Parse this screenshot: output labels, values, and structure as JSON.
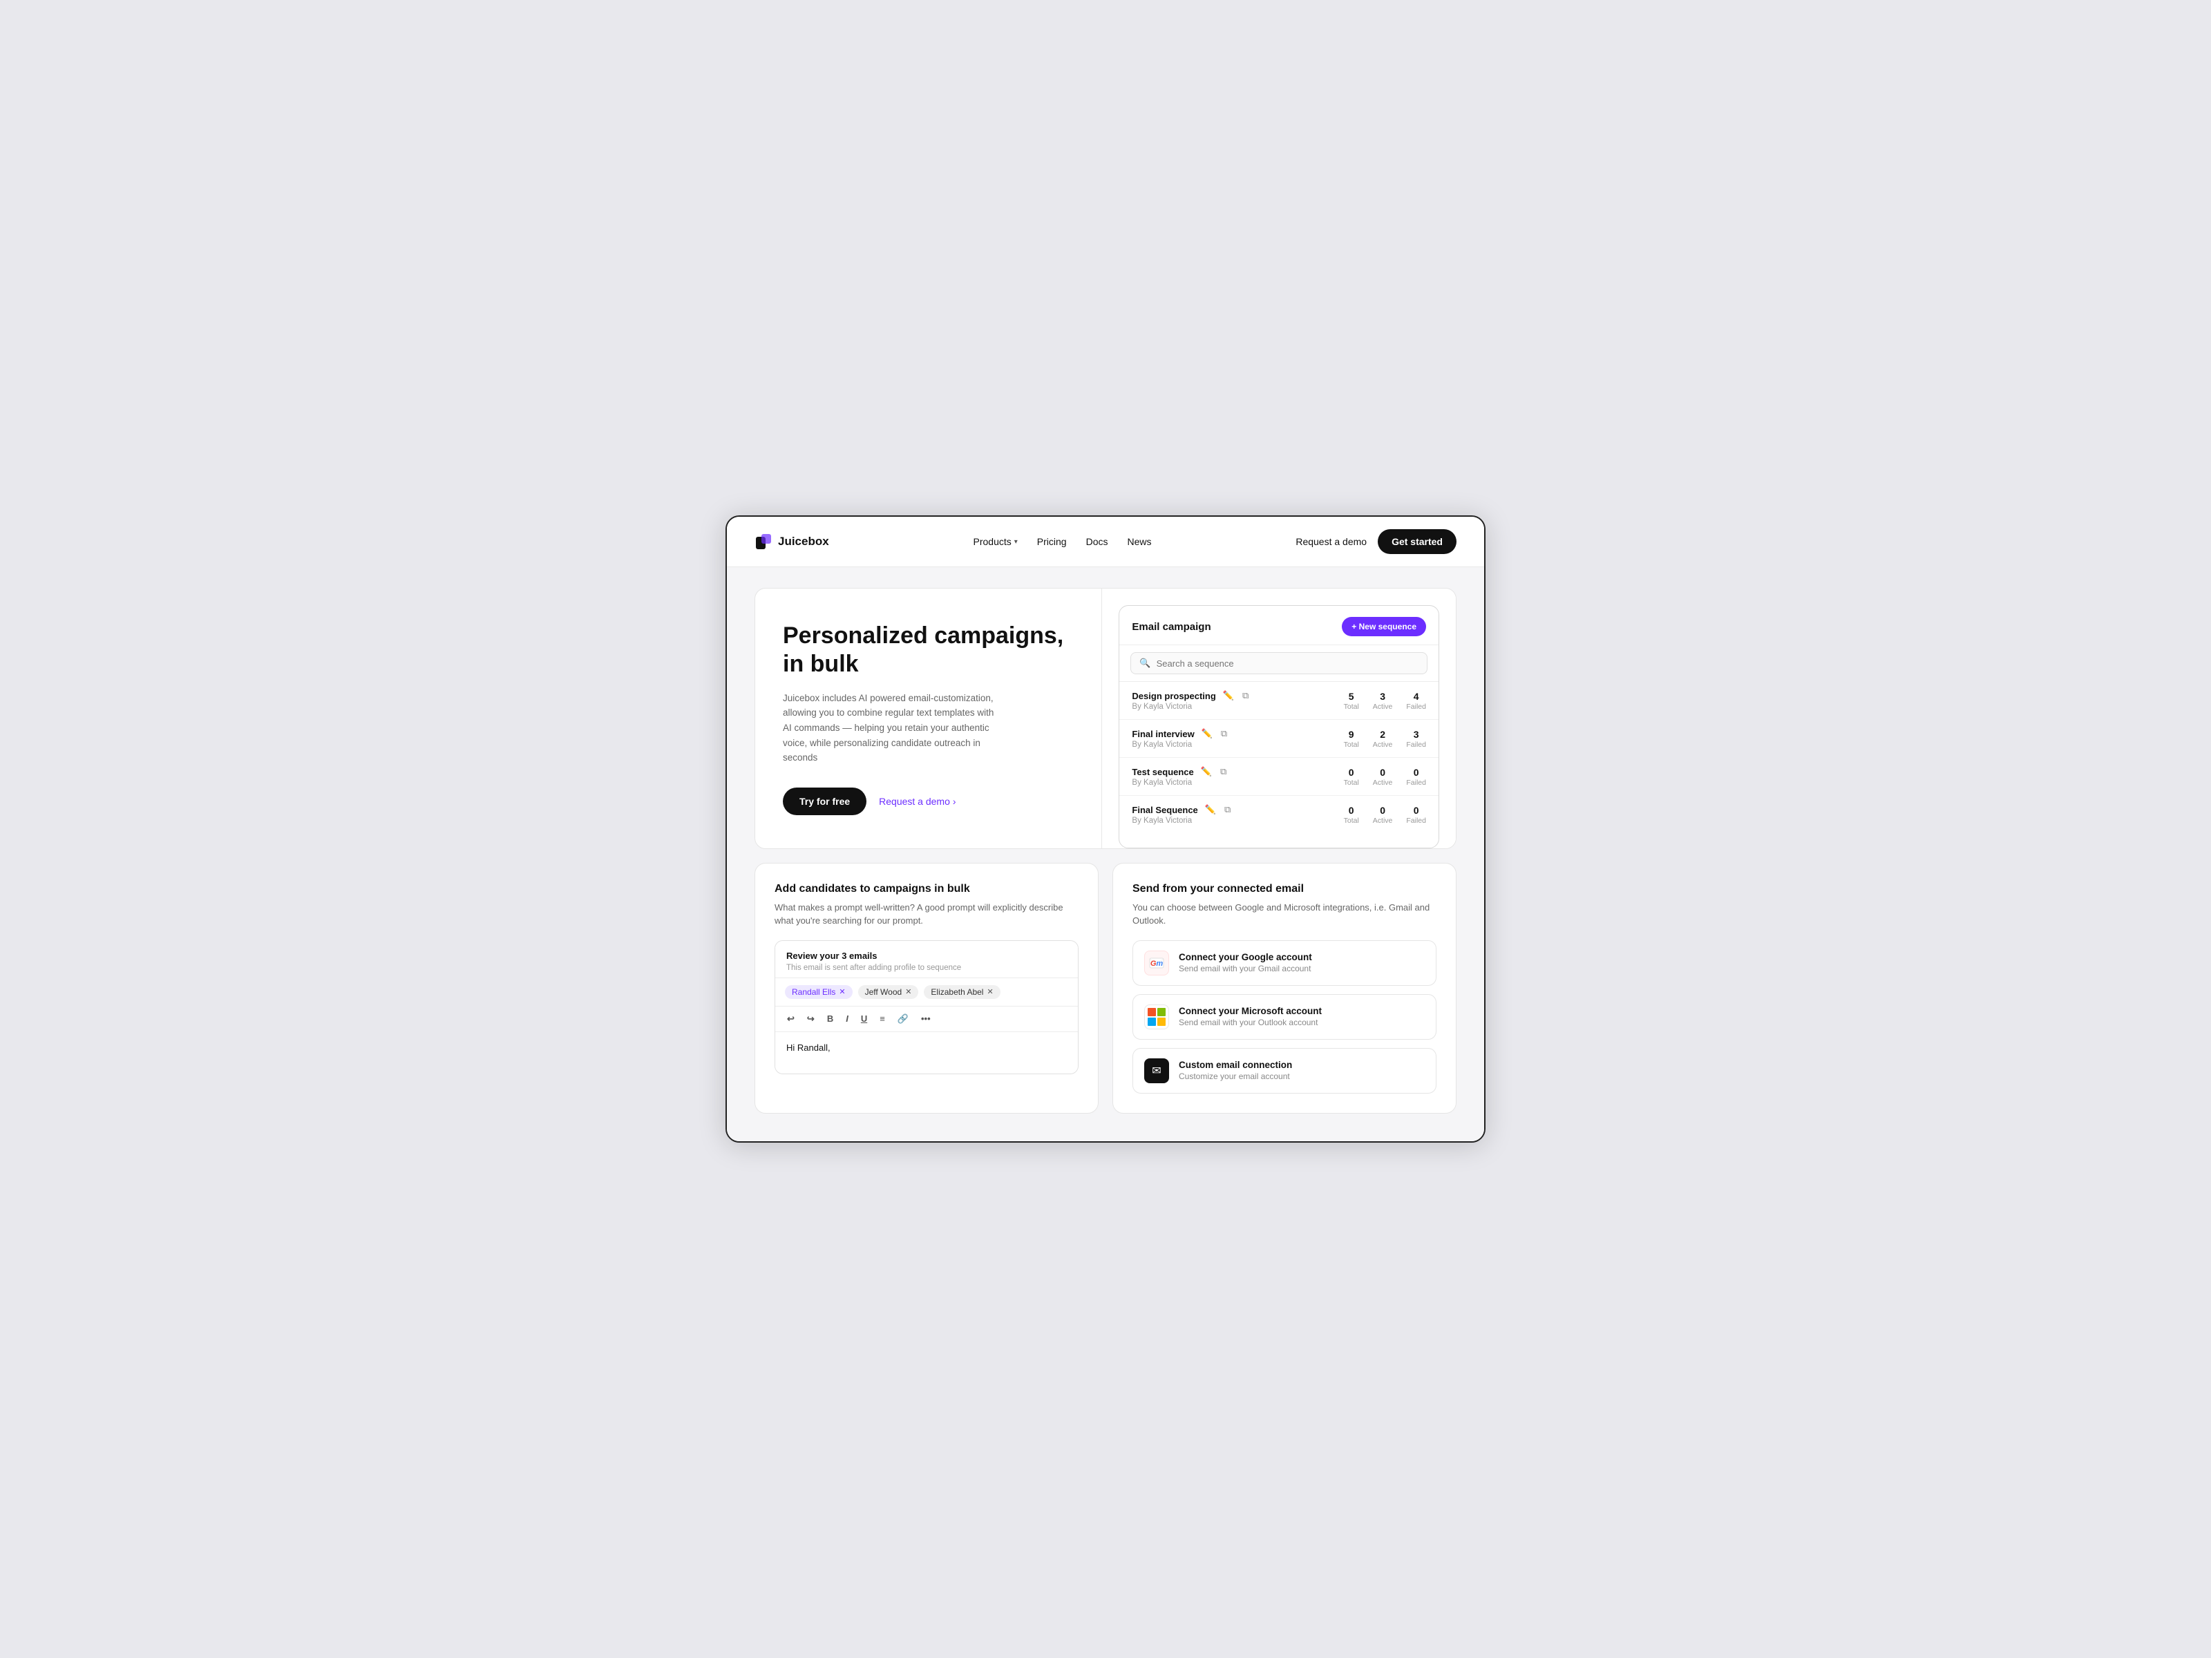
{
  "brand": {
    "name": "Juicebox",
    "logo_alt": "juicebox-logo"
  },
  "navbar": {
    "products_label": "Products",
    "pricing_label": "Pricing",
    "docs_label": "Docs",
    "news_label": "News",
    "request_demo_label": "Request a demo",
    "get_started_label": "Get started"
  },
  "hero": {
    "title": "Personalized campaigns, in bulk",
    "description": "Juicebox includes AI powered email-customization, allowing you to combine regular text templates with AI commands — helping you retain your authentic voice, while personalizing candidate outreach in seconds",
    "try_free_label": "Try for free",
    "request_demo_label": "Request a demo",
    "request_demo_arrow": "›"
  },
  "campaign_card": {
    "title": "Email campaign",
    "new_sequence_label": "+ New sequence",
    "search_placeholder": "Search a sequence",
    "rows": [
      {
        "name": "Design prospecting",
        "by": "By Kayla Victoria",
        "total": 5,
        "total_label": "Total",
        "active": 3,
        "active_label": "Active",
        "failed": 4,
        "failed_label": "Failed"
      },
      {
        "name": "Final interview",
        "by": "By Kayla Victoria",
        "total": 9,
        "total_label": "Total",
        "active": 2,
        "active_label": "Active",
        "failed": 3,
        "failed_label": "Failed"
      },
      {
        "name": "Test sequence",
        "by": "By Kayla Victoria",
        "total": 0,
        "total_label": "Total",
        "active": 0,
        "active_label": "Active",
        "failed": 0,
        "failed_label": "Failed"
      },
      {
        "name": "Final Sequence",
        "by": "By Kayla Victoria",
        "total": 0,
        "total_label": "Total",
        "active": 0,
        "active_label": "Active",
        "failed": 0,
        "failed_label": "Failed"
      }
    ]
  },
  "candidates_card": {
    "title": "Add candidates to campaigns in bulk",
    "description": "What makes a prompt well-written? A good prompt will explicitly describe what you're searching for our prompt.",
    "compose": {
      "subject": "Review your 3 emails",
      "subtext": "This email is sent after adding profile to sequence",
      "tags": [
        {
          "label": "Randall Ells",
          "type": "purple"
        },
        {
          "label": "Jeff Wood",
          "type": "plain"
        },
        {
          "label": "Elizabeth Abel",
          "type": "plain"
        }
      ],
      "toolbar": [
        "↩",
        "↪",
        "B",
        "I",
        "U",
        "≡",
        "🔗",
        "•••"
      ],
      "body_text": "Hi Randall,"
    }
  },
  "email_card": {
    "title": "Send from your connected email",
    "description": "You can choose between Google and Microsoft integrations, i.e. Gmail and Outlook.",
    "integrations": [
      {
        "id": "google",
        "name": "Connect your Google account",
        "desc": "Send email with your Gmail account",
        "icon_type": "gmail"
      },
      {
        "id": "microsoft",
        "name": "Connect your Microsoft account",
        "desc": "Send email with your Outlook account",
        "icon_type": "microsoft"
      },
      {
        "id": "custom",
        "name": "Custom email connection",
        "desc": "Customize your email account",
        "icon_type": "envelope"
      }
    ]
  }
}
